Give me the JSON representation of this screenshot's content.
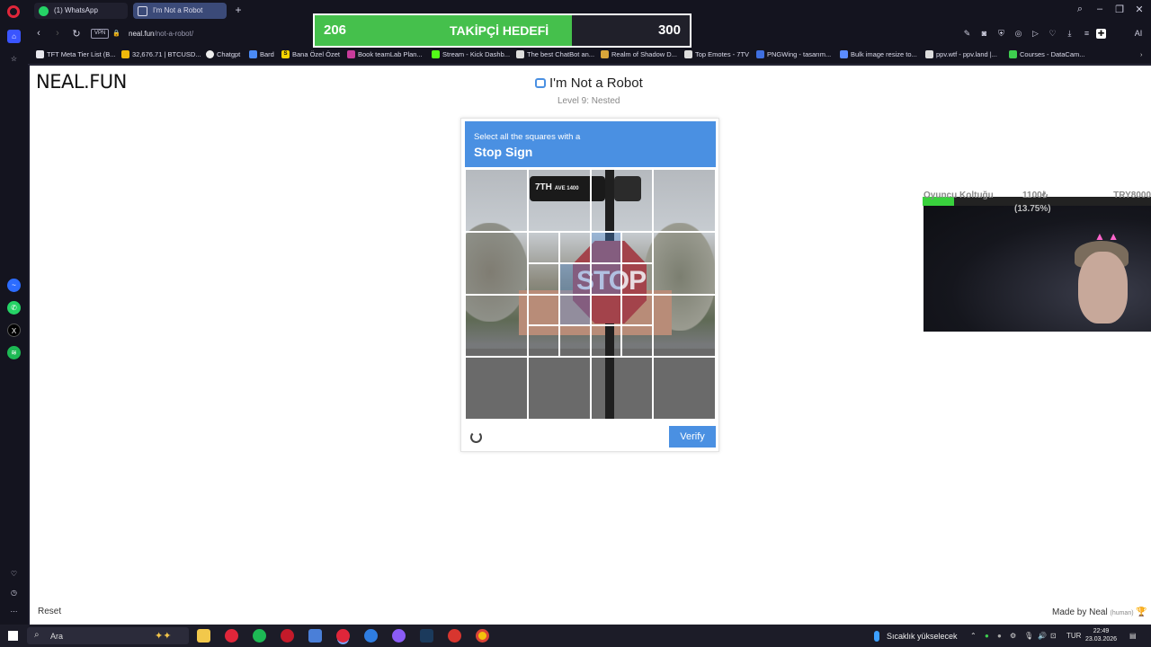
{
  "browser": {
    "tabs": [
      {
        "label": "(1) WhatsApp"
      },
      {
        "label": "I'm Not a Robot"
      }
    ],
    "address": {
      "vpn": "VPN",
      "domain": "neal.fun",
      "path": "/not-a-robot/"
    },
    "tool_ai_label": "AI",
    "bookmarks": [
      "TFT Meta Tier List (B...",
      "32,676.71 | BTCUSD...",
      "Chatgpt",
      "Bard",
      "Bana Özel Özet",
      "Book teamLab Plan...",
      "Stream - Kick Dashb...",
      "The best ChatBot an...",
      "Realm of Shadow D...",
      "Top Emotes - 7TV",
      "PNGWing - tasarım...",
      "Bulk image resize to...",
      "ppv.wtf - ppv.land |...",
      "Courses - DataCam..."
    ],
    "bookmark_icon_letters": [
      "S"
    ]
  },
  "goal": {
    "current": "206",
    "title": "TAKİPÇİ HEDEFİ",
    "max": "300",
    "progress": 0.6867
  },
  "page": {
    "logo": "NEAL.FUN",
    "title": "I'm Not a Robot",
    "subtitle": "Level 9: Nested",
    "captcha": {
      "line1": "Select all the squares with a",
      "line2": "Stop Sign",
      "street_sign": "7TH",
      "street_sign_small": "AVE 1400",
      "stop_text": "STOP",
      "verify": "Verify"
    },
    "reset": "Reset",
    "made_by": "Made by Neal",
    "made_by_tag": "(human)"
  },
  "overlay": {
    "label_left": "Oyuncu Koltuğu",
    "label_mid": "1100₺",
    "label_right": "TRY8000",
    "percent": "(13.75%)",
    "progress": 0.1375
  },
  "taskbar": {
    "search_placeholder": "Ara",
    "weather": "Sıcaklık yükselecek",
    "lang": "TUR",
    "time": "22:49",
    "date": "23.03.2026"
  },
  "colors": {
    "accent": "#4a90e2",
    "goal_green": "#45c04c",
    "opera_red": "#e0263a"
  }
}
